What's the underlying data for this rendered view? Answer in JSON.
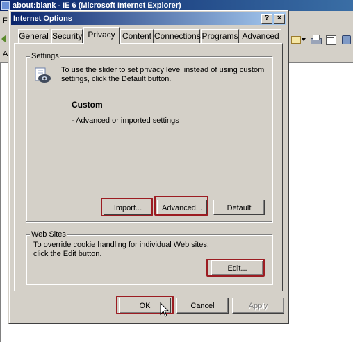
{
  "background_window": {
    "title": "about:blank - IE 6 (Microsoft Internet Explorer)",
    "menu_fragment": "F",
    "address_fragment": "A"
  },
  "dialog": {
    "title": "Internet Options",
    "help_label": "?",
    "close_label": "×",
    "tabs": [
      {
        "label": "General"
      },
      {
        "label": "Security"
      },
      {
        "label": "Privacy"
      },
      {
        "label": "Content"
      },
      {
        "label": "Connections"
      },
      {
        "label": "Programs"
      },
      {
        "label": "Advanced"
      }
    ],
    "active_tab": "Privacy",
    "settings": {
      "group_label": "Settings",
      "description_line1": "To use the slider to set privacy level instead of using custom",
      "description_line2": "settings, click the Default button.",
      "level_name": "Custom",
      "level_detail": "- Advanced or imported settings",
      "import_button": "Import...",
      "advanced_button": "Advanced...",
      "default_button": "Default"
    },
    "web_sites": {
      "group_label": "Web Sites",
      "description_line1": "To override cookie handling for individual Web sites,",
      "description_line2": "click the Edit button.",
      "edit_button": "Edit..."
    },
    "ok_button": "OK",
    "cancel_button": "Cancel",
    "apply_button": "Apply"
  },
  "colors": {
    "dialog_face": "#d4d0c8",
    "title_active": "#0a246a",
    "highlight_box": "#9c1c22"
  }
}
